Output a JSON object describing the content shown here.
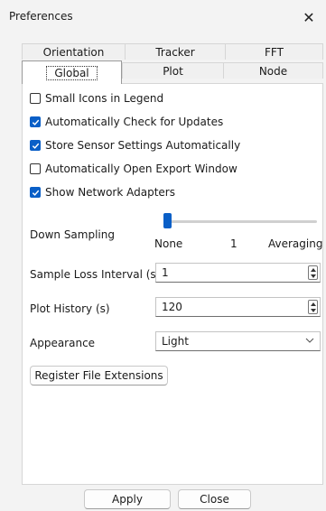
{
  "window": {
    "title": "Preferences",
    "close_glyph": "✕"
  },
  "tabs": {
    "row1": [
      "Orientation",
      "Tracker",
      "FFT"
    ],
    "row2": [
      "Global",
      "Plot",
      "Node"
    ],
    "active": "Global"
  },
  "options": [
    {
      "label": "Small Icons in Legend",
      "checked": false
    },
    {
      "label": "Automatically Check for Updates",
      "checked": true
    },
    {
      "label": "Store Sensor Settings Automatically",
      "checked": true
    },
    {
      "label": "Automatically Open Export Window",
      "checked": false
    },
    {
      "label": "Show Network Adapters",
      "checked": true
    }
  ],
  "down_sampling": {
    "label": "Down Sampling",
    "ticks": [
      "None",
      "1",
      "Averaging"
    ],
    "value_fraction": 0.0
  },
  "sample_loss": {
    "label": "Sample Loss Interval (s)",
    "value": "1"
  },
  "plot_history": {
    "label": "Plot History (s)",
    "value": "120"
  },
  "appearance": {
    "label": "Appearance",
    "value": "Light"
  },
  "register_label": "Register File Extensions",
  "footer": {
    "apply": "Apply",
    "close": "Close"
  },
  "colors": {
    "accent": "#0a5fc7"
  },
  "icons": {
    "check": "check-icon",
    "close": "close-icon",
    "chevron": "chevron-down-icon",
    "spin_up": "spin-up-icon",
    "spin_down": "spin-down-icon"
  }
}
